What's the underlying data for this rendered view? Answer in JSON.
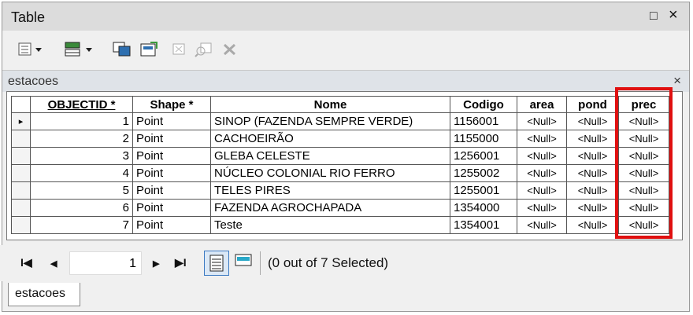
{
  "window": {
    "title": "Table",
    "restore_glyph": "□",
    "close_glyph": "×"
  },
  "toolbar": {
    "icons": [
      "table-options-icon",
      "related-tables-icon",
      "select-by-attributes-icon",
      "switch-selection-icon",
      "clear-selection-icon",
      "zoom-to-selected-icon",
      "delete-selected-icon"
    ]
  },
  "tab": {
    "label": "estacoes",
    "close_glyph": "×"
  },
  "table": {
    "columns": [
      "OBJECTID *",
      "Shape *",
      "Nome",
      "Codigo",
      "area",
      "pond",
      "prec"
    ],
    "rows": [
      [
        "1",
        "Point",
        "SINOP (FAZENDA SEMPRE VERDE)",
        "1156001",
        "<Null>",
        "<Null>",
        "<Null>"
      ],
      [
        "2",
        "Point",
        "CACHOEIRÃO",
        "1155000",
        "<Null>",
        "<Null>",
        "<Null>"
      ],
      [
        "3",
        "Point",
        "GLEBA CELESTE",
        "1256001",
        "<Null>",
        "<Null>",
        "<Null>"
      ],
      [
        "4",
        "Point",
        "NÚCLEO COLONIAL RIO FERRO",
        "1255002",
        "<Null>",
        "<Null>",
        "<Null>"
      ],
      [
        "5",
        "Point",
        "TELES PIRES",
        "1255001",
        "<Null>",
        "<Null>",
        "<Null>"
      ],
      [
        "6",
        "Point",
        "FAZENDA AGROCHAPADA",
        "1354000",
        "<Null>",
        "<Null>",
        "<Null>"
      ],
      [
        "7",
        "Point",
        "Teste",
        "1354001",
        "<Null>",
        "<Null>",
        "<Null>"
      ]
    ],
    "current_row_indicator": "▸"
  },
  "navigation": {
    "first": "I◀",
    "prev": "◀",
    "record": "1",
    "next": "▶",
    "last": "▶I"
  },
  "status": {
    "text": "(0 out of 7 Selected)"
  },
  "bottom_tab": {
    "label": "estacoes"
  },
  "colors": {
    "highlight_box": "#e01010"
  }
}
